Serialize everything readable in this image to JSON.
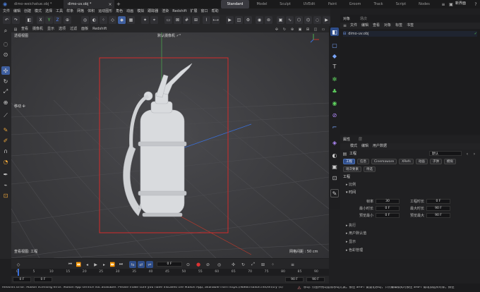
{
  "title_bar": {
    "tabs": [
      "dimo-weichatue.obj *",
      "dimo-uv.obj *"
    ],
    "add": "+",
    "layouts": [
      "Standard",
      "Model",
      "Sculpt",
      "UVEdit",
      "Paint",
      "Groom",
      "Track",
      "Script",
      "Nodes"
    ],
    "new_layout": "新界面"
  },
  "menu": [
    "文件",
    "编辑",
    "创建",
    "模式",
    "选择",
    "工具",
    "样条",
    "网格",
    "体积",
    "运动图形",
    "角色",
    "动画",
    "模拟",
    "跟踪器",
    "渲染",
    "Redshift",
    "扩展",
    "窗口",
    "帮助"
  ],
  "viewport_menu": [
    "查看",
    "摄像机",
    "显示",
    "选项",
    "过滤",
    "面板",
    "Redshift"
  ],
  "viewport": {
    "label": "透视视图",
    "camera": "默认摄像机 ✓°",
    "left_hint": "移动 ✣",
    "axis_label": "查看视图: 工程",
    "grid_info": "网格间距 : 50 cm"
  },
  "objects_panel": {
    "tabs": [
      "对象",
      "场次"
    ],
    "menu": [
      "文件",
      "编辑",
      "查看",
      "对象",
      "标签",
      "书签"
    ],
    "items": [
      {
        "name": "dimo-uv.obj"
      }
    ]
  },
  "attributes_panel": {
    "tabs": [
      "属性",
      "层"
    ],
    "menu": [
      "模式",
      "编辑",
      "用户数据"
    ],
    "object_name": "工程",
    "preset": "默认",
    "buttons": [
      "工程",
      "信息",
      "Cinemaware",
      "XRefs",
      "动画",
      "子弹",
      "模拟"
    ],
    "buttons2": [
      "场次要素",
      "待选"
    ],
    "section": "工程",
    "sub_scale": "比例",
    "sub_timing": "时间",
    "fields": [
      {
        "label": "帧率",
        "value": "30",
        "label2": "工程时长",
        "value2": "0 F"
      },
      {
        "label": "最小时长",
        "value": "0 F",
        "label2": "最大时长",
        "value2": "90 F"
      },
      {
        "label": "预览最小",
        "value": "0 F",
        "label2": "预览最大",
        "value2": "90 F"
      }
    ],
    "collapsed": [
      "执行",
      "用户默认值",
      "显示",
      "色彩管理"
    ]
  },
  "timeline": {
    "current": "0 F",
    "ticks": [
      "0",
      "5",
      "10",
      "15",
      "20",
      "25",
      "30",
      "35",
      "40",
      "45",
      "50",
      "55",
      "60",
      "65",
      "70",
      "75",
      "80",
      "85",
      "90"
    ],
    "start": "0 F",
    "start2": "0 F",
    "end": "90 F",
    "end2": "90 F"
  },
  "status": {
    "message": "Redshift Error: Maxon licensing error: Maxon App service not available. Please make sure you have installed the Maxon App, available from https://www.maxon.net/en/try (4)",
    "hint": "移动: 点击并拖动鼠标移动元素。按住 SHIFT 键量化移动，节点编辑模式时按住 SHIFT 键增加选择对象；按住"
  },
  "colors": {
    "accent": "#2e4d8a",
    "selection_frame": "#d42b2b",
    "axis_green": "#4caf50",
    "axis_red": "#c0392b"
  }
}
